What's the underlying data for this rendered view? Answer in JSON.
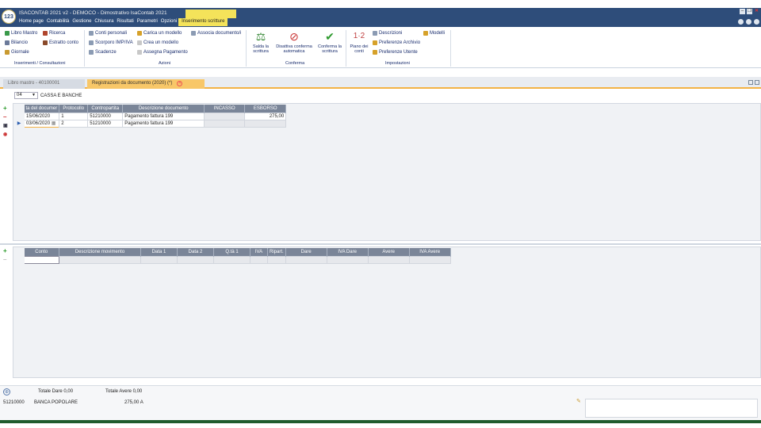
{
  "app": {
    "logo_text": "123",
    "title": "ISACONTAB 2021 v2 - DEMOCO - Dimostrativo IsaContab 2021"
  },
  "menu": {
    "items": [
      "Home page",
      "Contabilità",
      "Gestione",
      "Chiusura",
      "Risultati",
      "Parametri",
      "Opzioni"
    ],
    "active": "Inserimento scritture"
  },
  "ribbon": {
    "inserimenti": {
      "libro_mastro": "Libro Mastro",
      "ricerca": "Ricerca",
      "bilancio": "Bilancio",
      "estratto_conto": "Estratto conto",
      "giornale": "Giornale",
      "group_label": "Inserimenti / Consultazioni"
    },
    "azioni": {
      "conti_personali": "Conti personali",
      "scorporo": "Scorporo IMP/IVA",
      "scadenze": "Scadenze",
      "carica_modello": "Carica un modello",
      "crea_modello": "Crea un modello",
      "assegna_pagamento": "Assegna Pagamento",
      "associa_documento": "Associa documento/i",
      "group_label": "Azioni"
    },
    "conferma": {
      "salda": "Salda la scrittura",
      "disattiva": "Disattiva conferma automatica",
      "conferma": "Conferma la scrittura",
      "group_label": "Conferma"
    },
    "impostazioni": {
      "piano": "Piano dei conti",
      "descrizioni": "Descrizioni",
      "pref_archivio": "Preferenze Archivio",
      "pref_utente": "Preferenze Utente",
      "modelli": "Modelli",
      "group_label": "Impostazioni"
    }
  },
  "tabs": {
    "inactive": "Libro mastro - 40100001",
    "active": "Registrazioni da documento (2020) (*)"
  },
  "journal": {
    "code": "04",
    "label": "CASSA E BANCHE"
  },
  "grid1": {
    "headers": [
      "ta del documer",
      "Protocollo",
      "Contropartita",
      "Descrizione documento",
      "INCASSO",
      "ESBORSO"
    ],
    "rows": [
      {
        "date": "15/06/2020",
        "protocol": "1",
        "counter": "51210000",
        "desc": "Pagamento fattura 199",
        "incasso": "",
        "esborso": "275,00"
      },
      {
        "date": "03/06/2020",
        "protocol": "2",
        "counter": "51210000",
        "desc": "Pagamento fattura 199",
        "incasso": "",
        "esborso": ""
      }
    ]
  },
  "grid2": {
    "headers": [
      "Conto",
      "Descrizione movimento",
      "Data 1",
      "Data 2",
      "Q.tà 1",
      "IVA",
      "Ripart.",
      "Dare",
      "IVA Dare",
      "Avere",
      "IVA Avere"
    ]
  },
  "footer": {
    "totale_dare": "Totale Dare 0,00",
    "totale_avere": "Totale Avere 0,00",
    "account_code": "51210000",
    "account_name": "BANCA POPOLARE",
    "account_amount": "275,00 A"
  },
  "colors": {
    "titlebar": "#2e4d7a",
    "accent_yellow": "#f4e35a",
    "tab_orange": "#f8c768",
    "grid_header": "#7a8598"
  }
}
